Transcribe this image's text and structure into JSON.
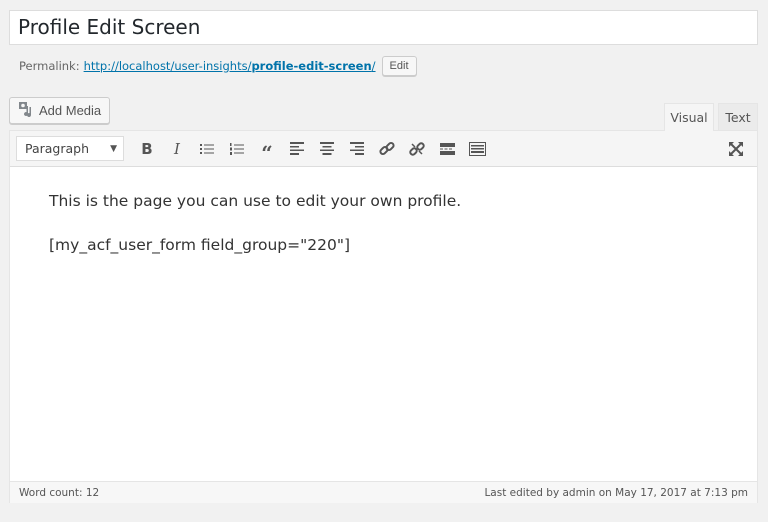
{
  "title": "Profile Edit Screen",
  "permalink": {
    "label": "Permalink:",
    "url_base": "http://localhost/user-insights/",
    "slug": "profile-edit-screen",
    "url_end": "/",
    "edit_label": "Edit"
  },
  "add_media": "Add Media",
  "tabs": {
    "visual": "Visual",
    "text": "Text"
  },
  "toolbar": {
    "format": "Paragraph",
    "buttons": [
      "bold-icon",
      "italic-icon",
      "bullet-list-icon",
      "numbered-list-icon",
      "blockquote-icon",
      "align-left-icon",
      "align-center-icon",
      "align-right-icon",
      "link-icon",
      "unlink-icon",
      "read-more-icon",
      "toolbar-toggle-icon",
      "fullscreen-icon"
    ]
  },
  "content": {
    "line1": "This is the page you can use to edit your own profile.",
    "line2": "[my_acf_user_form field_group=\"220\"]"
  },
  "status": {
    "word_count": "Word count: 12",
    "last_edited": "Last edited by admin on May 17, 2017 at 7:13 pm"
  }
}
